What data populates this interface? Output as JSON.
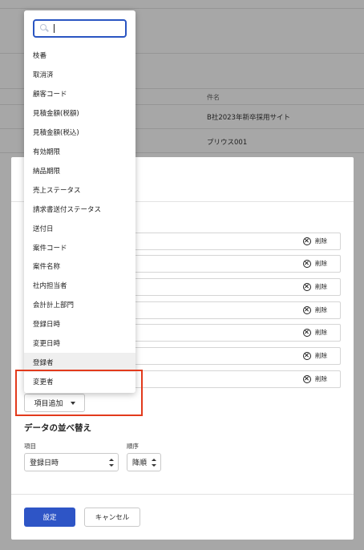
{
  "background": {
    "column_header": "件名",
    "rows": [
      "B社2023年新卒採用サイト",
      "プリウス001"
    ]
  },
  "dropdown": {
    "search": {
      "value": "",
      "placeholder": ""
    },
    "items": [
      "枝番",
      "取消済",
      "顧客コード",
      "見積金額(税額)",
      "見積金額(税込)",
      "有効期限",
      "納品期限",
      "売上ステータス",
      "請求書送付ステータス",
      "送付日",
      "案件コード",
      "案件名称",
      "社内担当者",
      "会計計上部門",
      "登録日時",
      "変更日時",
      "登録者",
      "変更者"
    ],
    "hovered_index": 16
  },
  "modal": {
    "item_rows": [
      {
        "delete_label": "削除"
      },
      {
        "delete_label": "削除"
      },
      {
        "delete_label": "削除"
      },
      {
        "delete_label": "削除"
      },
      {
        "delete_label": "削除"
      },
      {
        "delete_label": "削除"
      },
      {
        "delete_label": "削除"
      }
    ],
    "add_item_label": "項目追加",
    "sort": {
      "title": "データの並べ替え",
      "field_label": "項目",
      "field_value": "登録日時",
      "order_label": "順序",
      "order_value": "降順"
    },
    "ok_label": "設定",
    "cancel_label": "キャンセル"
  },
  "colors": {
    "primary": "#2e55c6",
    "highlight": "#e23a1c",
    "search_focus": "#2a55c2"
  }
}
